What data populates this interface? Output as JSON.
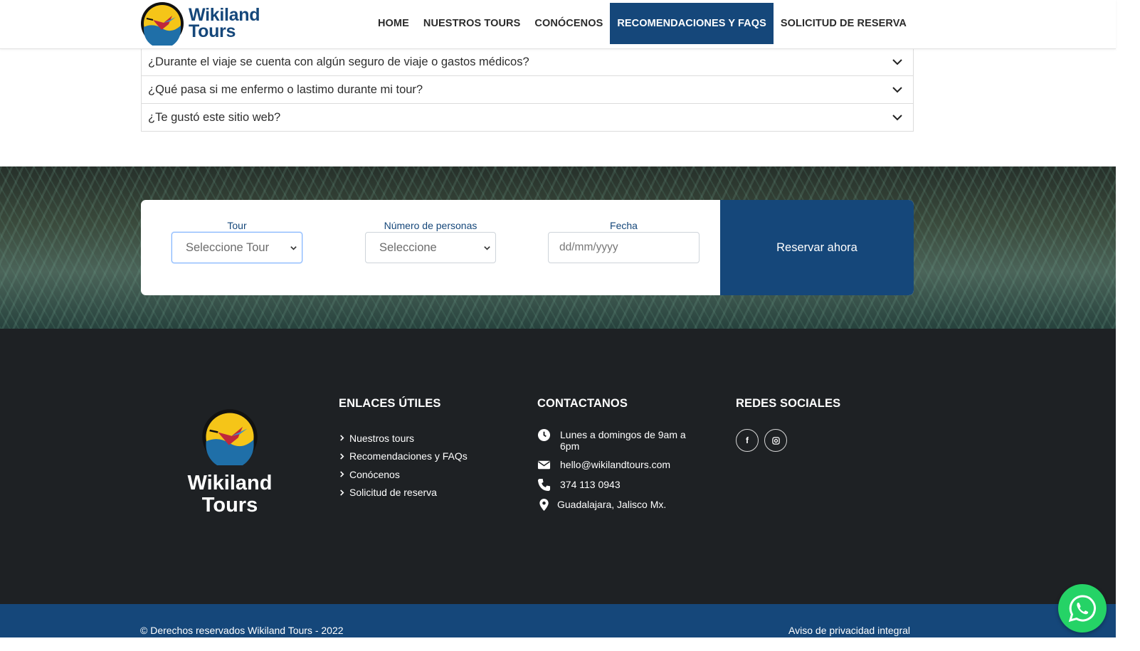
{
  "brand": {
    "name_line1": "Wikiland",
    "name_line2": "Tours",
    "primary_color": "#15477a"
  },
  "nav": {
    "items": [
      {
        "label": "HOME"
      },
      {
        "label": "NUESTROS TOURS"
      },
      {
        "label": "CONÓCENOS"
      },
      {
        "label": "RECOMENDACIONES Y FAQS",
        "active": true
      },
      {
        "label": "SOLICITUD DE RESERVA"
      }
    ]
  },
  "faq": {
    "items": [
      {
        "question": "¿Durante el viaje se cuenta con algún seguro de viaje o gastos médicos?"
      },
      {
        "question": "¿Qué pasa si me enfermo o lastimo durante mi tour?"
      },
      {
        "question": "¿Te gustó este sitio web?"
      }
    ],
    "icon": "chevron-down-icon"
  },
  "booking": {
    "tour_label": "Tour",
    "tour_value": "Seleccione Tour",
    "people_label": "Número de personas",
    "people_value": "Seleccione",
    "date_label": "Fecha",
    "date_placeholder": "dd/mm/yyyy",
    "submit_label": "Reservar ahora"
  },
  "footer": {
    "logo_line1": "Wikiland",
    "logo_line2": "Tours",
    "links_title": "ENLACES ÚTILES",
    "links": [
      {
        "label": "Nuestros tours"
      },
      {
        "label": "Recomendaciones y FAQs"
      },
      {
        "label": "Conócenos"
      },
      {
        "label": "Solicitud de reserva"
      }
    ],
    "contact_title": "CONTACTANOS",
    "contact": {
      "hours": "Lunes a domingos de 9am a 6pm",
      "email": "hello@wikilandtours.com",
      "phone": "374 113 0943",
      "location": "Guadalajara, Jalisco Mx."
    },
    "social_title": "REDES SOCIALES",
    "social": [
      {
        "icon": "facebook-icon",
        "glyph": "f"
      },
      {
        "icon": "instagram-icon",
        "glyph": "◘"
      }
    ],
    "background_color": "#1e2124"
  },
  "bottom_bar": {
    "copyright": "© Derechos reservados Wikiland Tours - 2022",
    "privacy": "Aviso de privacidad integral"
  },
  "whatsapp": {
    "icon": "whatsapp-icon",
    "color": "#25d366"
  }
}
